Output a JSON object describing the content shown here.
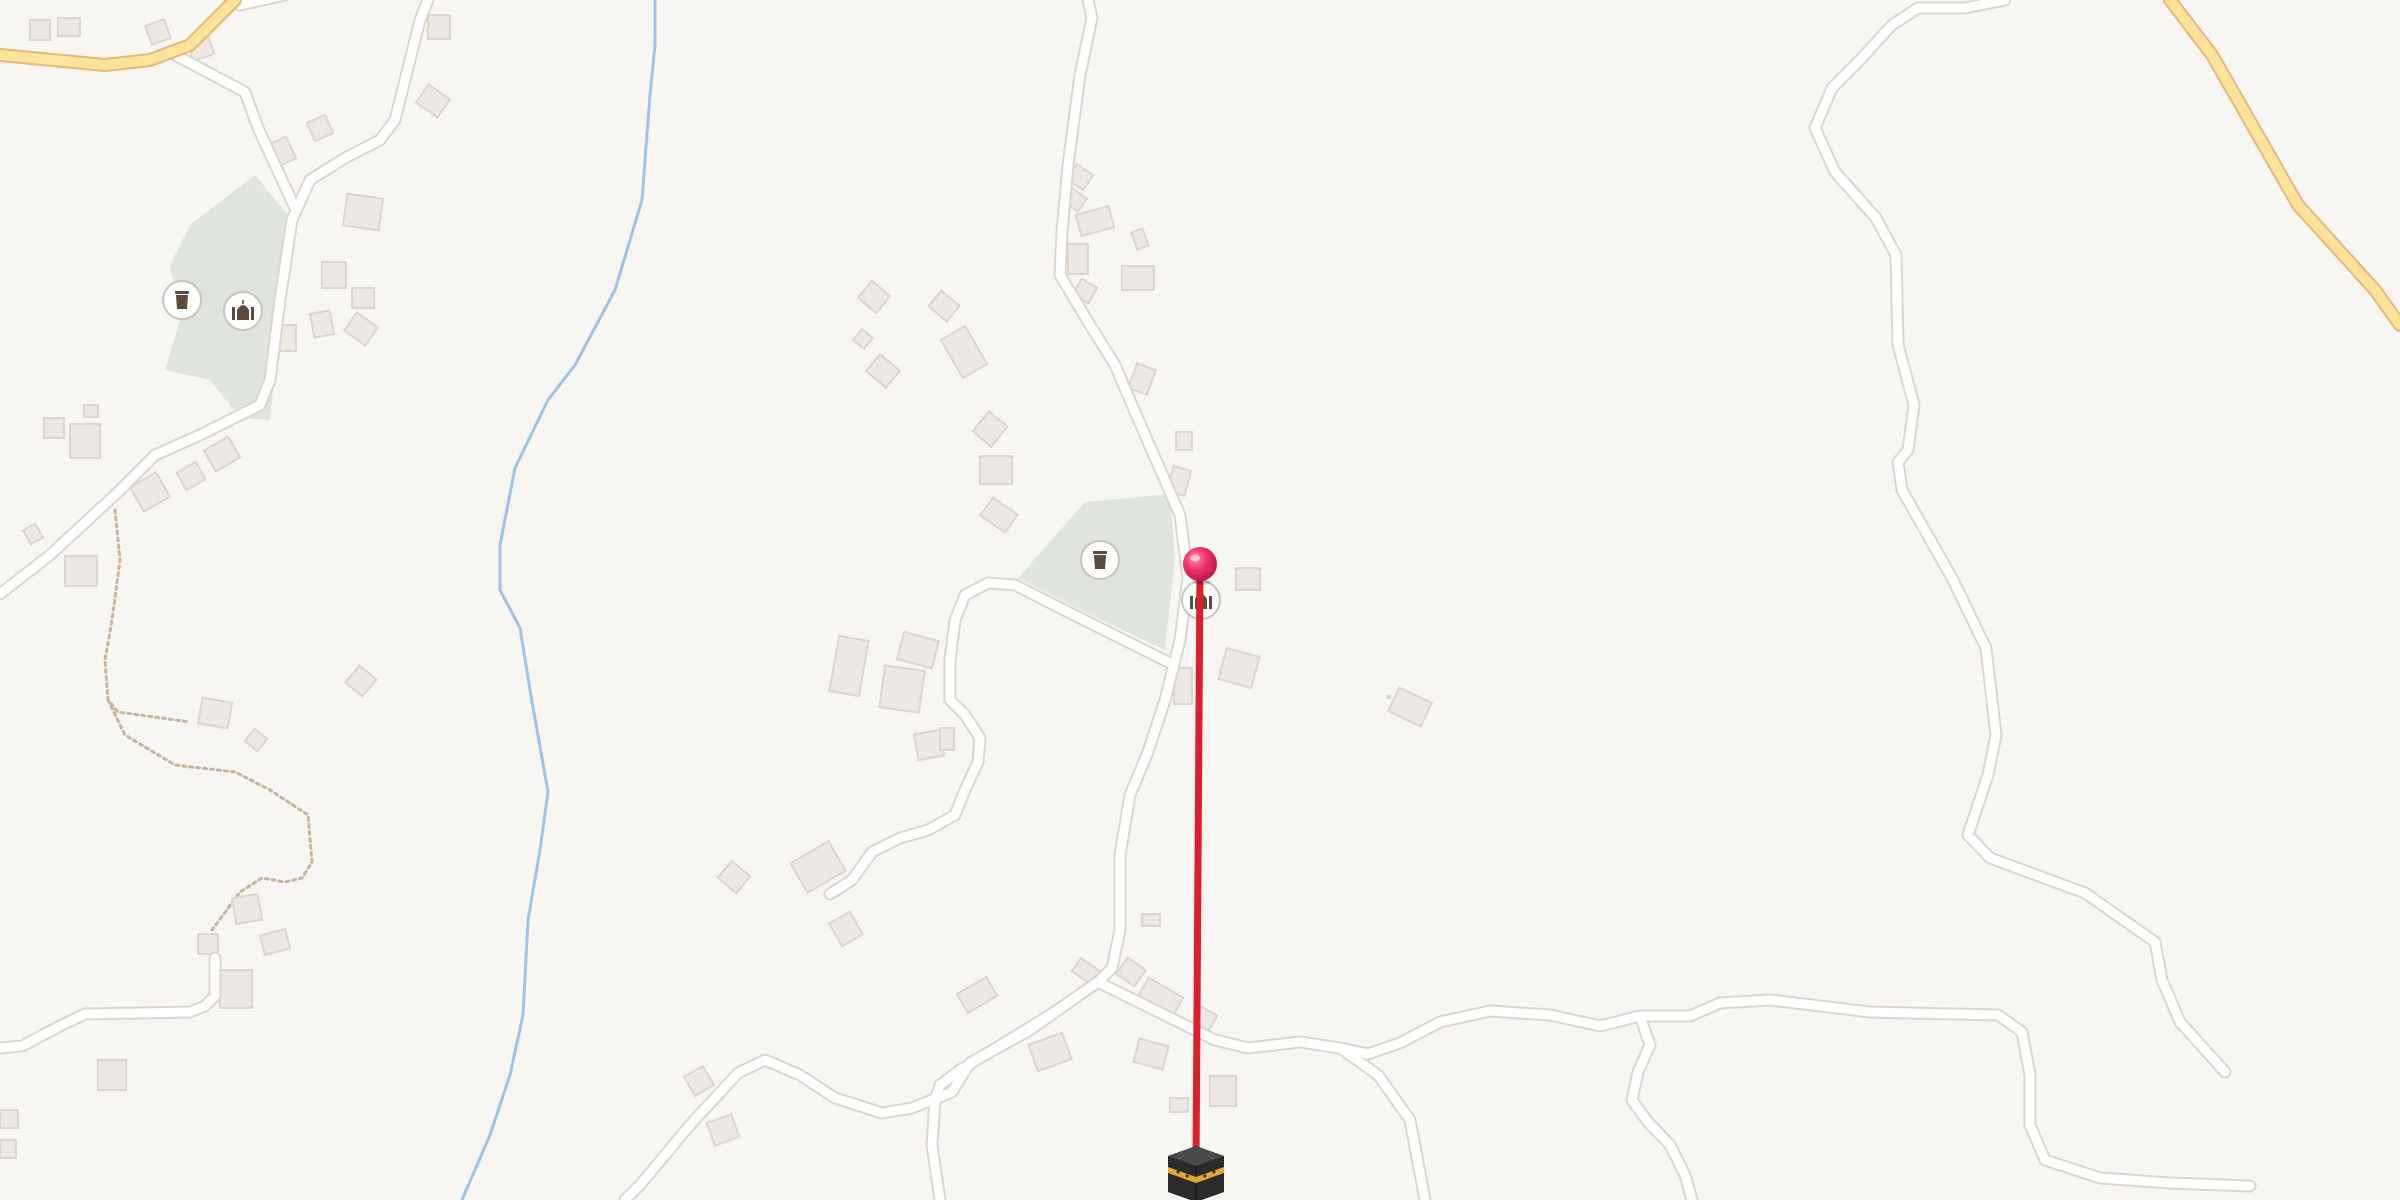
{
  "map": {
    "style": "light vector street map",
    "colors": {
      "background": "#f8f6f3",
      "road_fill": "#ffffff",
      "road_casing": "#dcd6cf",
      "major_road_fill": "#fde49a",
      "major_road_casing": "#e6b87a",
      "river": "#9fc3e8",
      "park": "#e0e4de",
      "building": "#ede8e3",
      "building_shadow": "#ddd6ce",
      "path": "#c9b49c",
      "qibla_line": "#d9202b",
      "location_pin": "#f0336d"
    },
    "markers": [
      {
        "id": "current-location-pin",
        "icon": "pink-location-pin-icon"
      },
      {
        "id": "kaaba",
        "icon": "kaaba-icon"
      }
    ],
    "pois": [
      {
        "id": "cemetery-1",
        "icon": "cemetery-icon"
      },
      {
        "id": "mosque-1",
        "icon": "mosque-icon"
      },
      {
        "id": "cemetery-2",
        "icon": "cemetery-icon"
      },
      {
        "id": "mosque-2",
        "icon": "mosque-icon"
      }
    ],
    "overlay": {
      "type": "qibla-direction-line",
      "from": "current-location-pin",
      "to": "kaaba"
    }
  }
}
